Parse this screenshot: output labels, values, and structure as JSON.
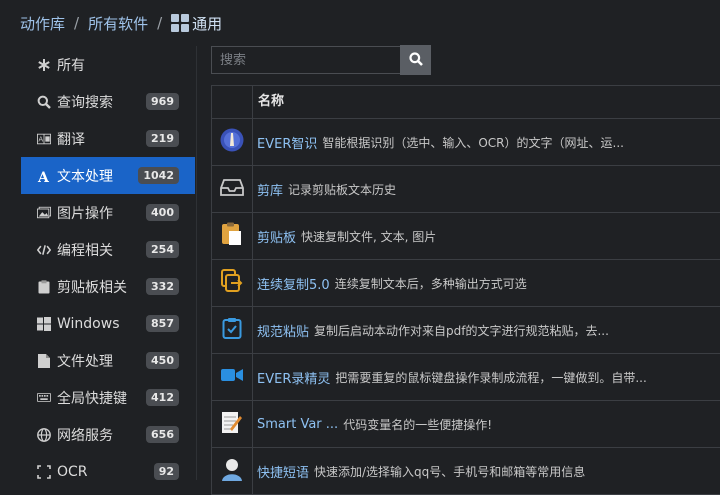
{
  "breadcrumb": {
    "root": "动作库",
    "sep1": "/",
    "middle": "所有软件",
    "sep2": "/",
    "current": "通用"
  },
  "search": {
    "placeholder": "搜索"
  },
  "sidebar": {
    "items": [
      {
        "label": "所有",
        "count": "",
        "icon": "asterisk-icon"
      },
      {
        "label": "查询搜索",
        "count": "969",
        "icon": "search-icon"
      },
      {
        "label": "翻译",
        "count": "219",
        "icon": "translate-icon"
      },
      {
        "label": "文本处理",
        "count": "1042",
        "icon": "font-icon",
        "active": true
      },
      {
        "label": "图片操作",
        "count": "400",
        "icon": "images-icon"
      },
      {
        "label": "编程相关",
        "count": "254",
        "icon": "code-icon"
      },
      {
        "label": "剪贴板相关",
        "count": "332",
        "icon": "clipboard-icon"
      },
      {
        "label": "Windows",
        "count": "857",
        "icon": "windows-icon"
      },
      {
        "label": "文件处理",
        "count": "450",
        "icon": "file-icon"
      },
      {
        "label": "全局快捷键",
        "count": "412",
        "icon": "keyboard-icon"
      },
      {
        "label": "网络服务",
        "count": "656",
        "icon": "globe-icon"
      },
      {
        "label": "OCR",
        "count": "92",
        "icon": "ocr-icon"
      }
    ]
  },
  "table": {
    "header": "名称",
    "rows": [
      {
        "name": "EVER智识",
        "desc": "智能根据识别（选中、输入、OCR）的文字（网址、运...",
        "icon": "ever-logo-icon"
      },
      {
        "name": "剪库",
        "desc": "记录剪贴板文本历史",
        "icon": "inbox-icon"
      },
      {
        "name": "剪贴板",
        "desc": "快速复制文件, 文本, 图片",
        "icon": "clipboard-paste-icon"
      },
      {
        "name": "连续复制5.0",
        "desc": "连续复制文本后，多种输出方式可选",
        "icon": "copy-export-icon"
      },
      {
        "name": "规范粘贴",
        "desc": "复制后启动本动作对来自pdf的文字进行规范粘贴，去...",
        "icon": "clipboard-check-icon"
      },
      {
        "name": "EVER录精灵",
        "desc": "把需要重复的鼠标键盘操作录制成流程，一键做到。自带...",
        "icon": "video-camera-icon"
      },
      {
        "name": "Smart Var ...",
        "desc": "代码变量名的一些便捷操作!",
        "icon": "notepad-pen-icon"
      },
      {
        "name": "快捷短语",
        "desc": "快速添加/选择输入qq号、手机号和邮箱等常用信息",
        "icon": "user-avatar-icon"
      }
    ]
  },
  "colors": {
    "accent": "#1a64c8",
    "link": "#8ec1f2",
    "background": "#1f2124"
  }
}
